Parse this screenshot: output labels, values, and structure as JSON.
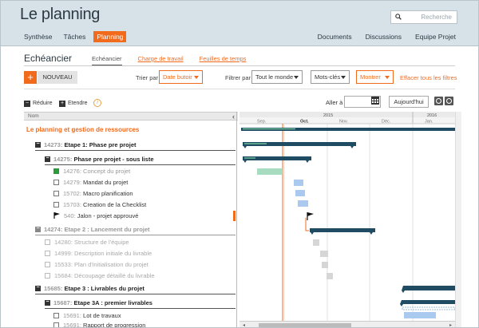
{
  "header": {
    "title": "Le planning",
    "search_placeholder": "Recherche",
    "nav_left": [
      "Synthèse",
      "Tâches",
      "Planning"
    ],
    "nav_active": "Planning",
    "nav_right": [
      "Documents",
      "Discussions",
      "Equipe Projet"
    ]
  },
  "sub": {
    "title": "Echéancier",
    "tabs": [
      "Echéancier",
      "Charge de travail",
      "Feuilles de temps"
    ]
  },
  "toolbar": {
    "add_label": "+",
    "new_label": "NOUVEAU",
    "sort_label": "Trier par",
    "sort_value": "Date butoir",
    "filter_label": "Filtrer par",
    "filter_value": "Tout le monde",
    "keywords_label": "Mots-clés",
    "show_label": "Montrer",
    "clear_filters": "Effacer tous les filtres"
  },
  "toolbar2": {
    "collapse_label": "Réduire",
    "expand_label": "Etendre",
    "info_icon": "i",
    "goto_label": "Aller à",
    "today_label": "Aujourd'hui"
  },
  "list": {
    "header": "Nom",
    "root": "Le planning et gestion de ressources",
    "rows": [
      {
        "id": "14273:",
        "name": "Etape 1: Phase pre projet",
        "kind": "group"
      },
      {
        "id": "14275:",
        "name": "Phase pre projet - sous liste",
        "kind": "group"
      },
      {
        "id": "14276:",
        "name": "Concept du projet",
        "kind": "task-checked"
      },
      {
        "id": "14279:",
        "name": "Mandat du projet",
        "kind": "task"
      },
      {
        "id": "15702:",
        "name": "Macro planification",
        "kind": "task"
      },
      {
        "id": "15703:",
        "name": "Creation de la Checklist",
        "kind": "task"
      },
      {
        "id": "540:",
        "name": "Jalon - projet approuvé",
        "kind": "milestone"
      },
      {
        "id": "14274:",
        "name": "Etape 2 : Lancement du projet",
        "kind": "group-grey"
      },
      {
        "id": "14280:",
        "name": "Structure de l'équipe",
        "kind": "task-grey"
      },
      {
        "id": "14999:",
        "name": "Description initiale du livrable",
        "kind": "task-grey"
      },
      {
        "id": "15533:",
        "name": "Plan d'initialisation du projet",
        "kind": "task-grey"
      },
      {
        "id": "15684:",
        "name": "Découpage détaillé du livrable",
        "kind": "task-grey"
      },
      {
        "id": "15685:",
        "name": "Etape 3 : Livrables du projet",
        "kind": "group"
      },
      {
        "id": "15687:",
        "name": "Etape 3A : premier livrables",
        "kind": "group"
      },
      {
        "id": "15691:",
        "name": "Lot de travaux",
        "kind": "task"
      },
      {
        "id": "15691:",
        "name": "Rapport de progression",
        "kind": "task"
      }
    ]
  },
  "timeline": {
    "years": [
      "2015",
      "2016"
    ],
    "months": [
      "Sep.",
      "Oct.",
      "Nov.",
      "Déc.",
      "Jan."
    ]
  },
  "colors": {
    "accent": "#f26b1d",
    "bar_dark": "#1f4c63",
    "bar_green": "#a8dcc0",
    "bar_blue": "#a9c9ee",
    "bar_grey": "#d6d6d6"
  }
}
